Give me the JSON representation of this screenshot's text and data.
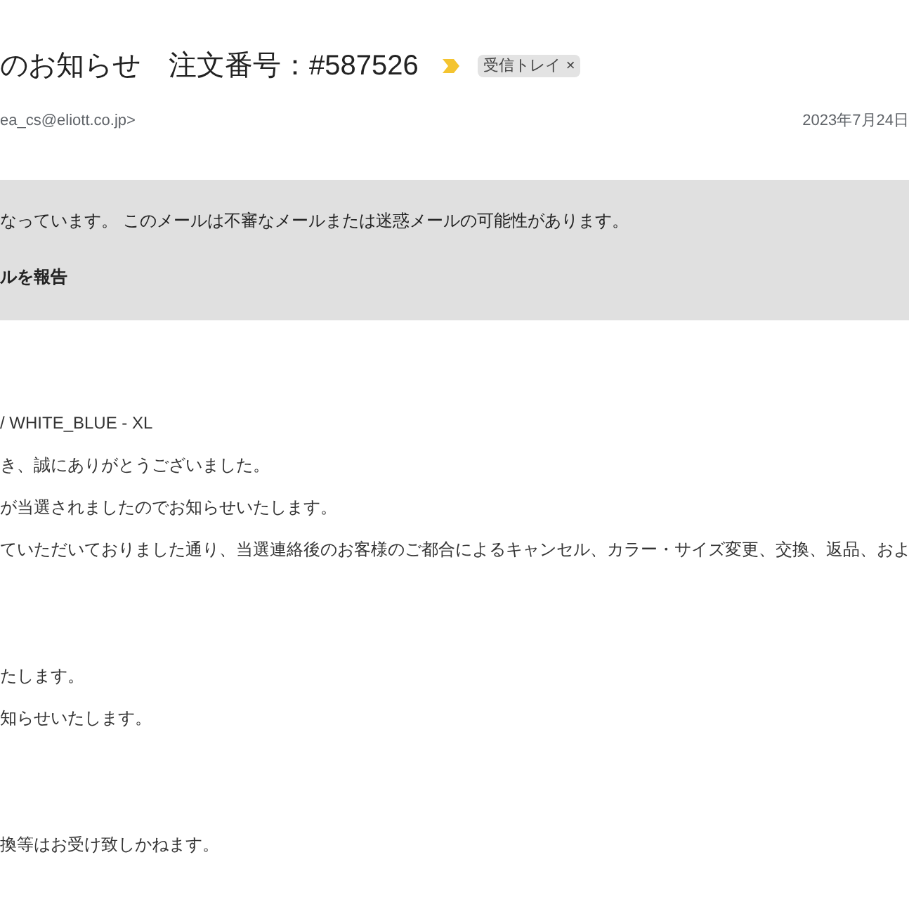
{
  "subject": "のお知らせ　注文番号：#587526",
  "label": {
    "text": "受信トレイ",
    "close": "×"
  },
  "sender": "ea_cs@eliott.co.jp>",
  "date": "2023年7月24日",
  "warning": {
    "message": "なっています。 このメールは不審なメールまたは迷惑メールの可能性があります。",
    "action": "ルを報告"
  },
  "paragraphs": [
    [
      "/ WHITE_BLUE - XL",
      "き、誠にありがとうございました。",
      "が当選されましたのでお知らせいたします。",
      "ていただいておりました通り、当選連絡後のお客様のご都合によるキャンセル、カラー・サイズ変更、交換、返品、およ"
    ],
    [
      "たします。",
      "知らせいたします。"
    ],
    [
      "換等はお受け致しかねます。"
    ]
  ]
}
